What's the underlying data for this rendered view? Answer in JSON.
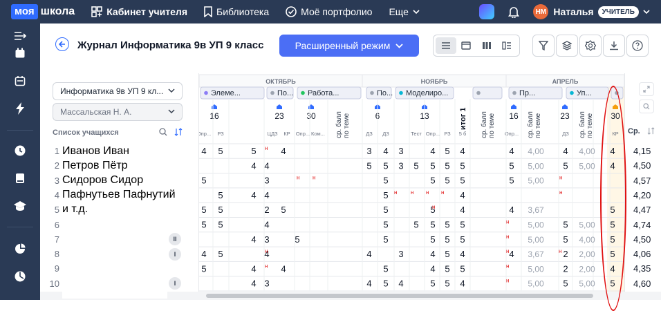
{
  "topbar": {
    "logo_moya": "моя",
    "logo_shkola": "школа",
    "nav": [
      "Кабинет учителя",
      "Библиотека",
      "Моё портфолио",
      "Еще"
    ],
    "avatar_initials": "НМ",
    "user_name": "Наталья",
    "role": "УЧИТЕЛЬ"
  },
  "header": {
    "title": "Журнал Информатика 9в УП 9 класс",
    "mode_button": "Расширенный режим"
  },
  "filters": {
    "subject": "Информатика 9в УП 9 кл...",
    "teacher": "Массальская Н. А."
  },
  "students_label": "Список учащихся",
  "students": [
    "Иванов Иван",
    "Петров Пётр",
    "Сидоров Сидор",
    "Пафнутьев Пафнутий",
    "и т.д."
  ],
  "row_numbers": [
    "1",
    "2",
    "3",
    "4",
    "5",
    "6",
    "7",
    "8",
    "9",
    "10"
  ],
  "row_badges": [
    {
      "row": 7,
      "label": "II"
    },
    {
      "row": 8,
      "label": "I"
    },
    {
      "row": 10,
      "label": "I"
    }
  ],
  "months": [
    "ОКТЯБРЬ",
    "НОЯБРЬ",
    "АПРЕЛЬ"
  ],
  "topics": [
    {
      "label": "Элеме...",
      "color": "#8b7cf6"
    },
    {
      "label": "По...",
      "color": "#9ca3af"
    },
    {
      "label": "Работа...",
      "color": "#22c55e"
    },
    {
      "label": "По...",
      "color": "#9ca3af"
    },
    {
      "label": "Моделиро...",
      "color": "#06b6d4"
    },
    {
      "label": "",
      "color": "#9ca3af"
    },
    {
      "label": "Пр...",
      "color": "#9ca3af"
    },
    {
      "label": "Уп...",
      "color": "#06b6d4"
    },
    {
      "label": "",
      "color": "#9ca3af"
    }
  ],
  "columns": [
    {
      "day": "16",
      "sub": [
        "Опр...",
        "РЗ"
      ]
    },
    {
      "vertical": "ср. балл по теме"
    },
    {
      "day": "23",
      "sub": [
        "ЦДЗ",
        "КР"
      ]
    },
    {
      "day": "30",
      "sub": [
        "Опр...",
        "Ком..."
      ]
    },
    {
      "vertical": "ср. балл по теме"
    },
    {
      "day": "6",
      "sub": [
        "ДЗ",
        "ДЗ"
      ]
    },
    {
      "day": "13",
      "sub": [
        "Тест",
        "Опр...",
        "РЗ"
      ]
    },
    {
      "vertical": "итог 1",
      "sub": [
        "5 б"
      ]
    },
    {
      "vertical": "ср. балл по теме"
    },
    {
      "day": "16",
      "sub": [
        "Опр..."
      ]
    },
    {
      "vertical": "ср. балл по теме"
    },
    {
      "day": "23",
      "sub": [
        "ДЗ"
      ]
    },
    {
      "vertical": "ср. балл по теме"
    },
    {
      "day": "30",
      "sub": [
        "КР"
      ]
    }
  ],
  "avg_header": "Ср.",
  "averages": [
    "4,15",
    "4,50",
    "4,57",
    "4,20",
    "4,47",
    "4,74",
    "4,50",
    "4,06",
    "4,35",
    "4,60"
  ],
  "grade_rows": [
    [
      "4",
      "5",
      "",
      "5",
      "",
      "4",
      "",
      "",
      "3",
      "4",
      "3",
      "",
      "4",
      "5",
      "4",
      "",
      "4",
      "4,00",
      "4",
      "4,00",
      "4"
    ],
    [
      "",
      "",
      "",
      "4",
      "4",
      "",
      "",
      "",
      "5",
      "5",
      "3",
      "5",
      "5",
      "5",
      "5",
      "",
      "5",
      "5,00",
      "5",
      "5,00",
      "4"
    ],
    [
      "5",
      "",
      "",
      "",
      "3",
      "",
      "",
      "",
      "",
      "5",
      "",
      "",
      "5",
      "5",
      "5",
      "",
      "5",
      "5,00",
      "",
      "",
      ""
    ],
    [
      "",
      "5",
      "",
      "4",
      "4",
      "",
      "",
      "",
      "",
      "5",
      "",
      "",
      "",
      "",
      "4",
      "",
      "",
      "",
      "",
      "",
      ""
    ],
    [
      "5",
      "5",
      "",
      "",
      "2",
      "5",
      "",
      "",
      "",
      "5",
      "",
      "",
      "5",
      "",
      "4",
      "",
      "4",
      "3,67",
      "",
      "",
      "5"
    ],
    [
      "5",
      "5",
      "",
      "",
      "4",
      "",
      "",
      "",
      "",
      "5",
      "",
      "5",
      "5",
      "5",
      "5",
      "",
      "",
      "5,00",
      "5",
      "5,00",
      "5"
    ],
    [
      "",
      "",
      "",
      "4",
      "3",
      "",
      "5",
      "",
      "",
      "5",
      "",
      "",
      "5",
      "5",
      "5",
      "",
      "",
      "5,00",
      "5",
      "4,00",
      "5"
    ],
    [
      "4",
      "5",
      "",
      "",
      "4",
      "",
      "",
      "",
      "4",
      "",
      "3",
      "",
      "4",
      "5",
      "4",
      "",
      "4",
      "3,67",
      "2",
      "2,00",
      "5"
    ],
    [
      "5",
      "",
      "",
      "4",
      "",
      "4",
      "",
      "",
      "",
      "5",
      "",
      "",
      "4",
      "5",
      "5",
      "",
      "",
      "5,00",
      "2",
      "2,00",
      "4"
    ],
    [
      "",
      "",
      "",
      "4",
      "3",
      "",
      "",
      "",
      "4",
      "5",
      "4",
      "",
      "5",
      "5",
      "4",
      "",
      "",
      "5,00",
      "5",
      "5,00",
      "5"
    ]
  ]
}
